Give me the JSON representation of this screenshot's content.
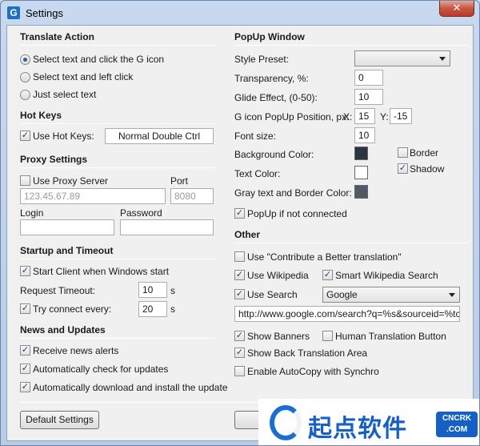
{
  "window": {
    "title": "Settings",
    "app_icon_glyph": "G",
    "close_glyph": "✕"
  },
  "translate_action": {
    "title": "Translate Action",
    "options": [
      {
        "label": "Select text and click the G icon",
        "selected": true
      },
      {
        "label": "Select text and left click",
        "selected": false
      },
      {
        "label": "Just select text",
        "selected": false
      }
    ]
  },
  "hot_keys": {
    "title": "Hot Keys",
    "use_label": "Use Hot Keys:",
    "checked": true,
    "value": "Normal Double Ctrl"
  },
  "proxy": {
    "title": "Proxy Settings",
    "use_label": "Use Proxy Server",
    "checked": false,
    "port_label": "Port",
    "server_value": "123.45.67.89",
    "port_value": "8080",
    "login_label": "Login",
    "password_label": "Password",
    "login_value": "",
    "password_value": ""
  },
  "startup": {
    "title": "Startup and Timeout",
    "start_client_label": "Start Client when Windows start",
    "start_client_checked": true,
    "request_timeout_label": "Request Timeout:",
    "request_timeout_value": "10",
    "request_timeout_unit": "s",
    "try_connect_label": "Try connect every:",
    "try_connect_checked": true,
    "try_connect_value": "20",
    "try_connect_unit": "s"
  },
  "news": {
    "title": "News and Updates",
    "items": [
      {
        "label": "Receive news alerts",
        "checked": true
      },
      {
        "label": "Automatically check for updates",
        "checked": true
      },
      {
        "label": "Automatically download and install the update",
        "checked": true
      }
    ]
  },
  "popup": {
    "title": "PopUp Window",
    "style_preset_label": "Style Preset:",
    "style_preset_value": "",
    "transparency_label": "Transparency, %:",
    "transparency_value": "0",
    "glide_label": "Glide Effect, (0-50):",
    "glide_value": "10",
    "position_label": "G icon PopUp Position, px:",
    "x_label": "X:",
    "x_value": "15",
    "y_label": "Y:",
    "y_value": "-15",
    "font_size_label": "Font size:",
    "font_size_value": "10",
    "bg_color_label": "Background Color:",
    "bg_color": "#2a3540",
    "text_color_label": "Text Color:",
    "text_color": "#ffffff",
    "gray_color_label": "Gray text and Border Color:",
    "gray_color": "#505a64",
    "border_label": "Border",
    "border_checked": false,
    "shadow_label": "Shadow",
    "shadow_checked": true,
    "popup_if_label": "PopUp if not connected",
    "popup_if_checked": true
  },
  "other": {
    "title": "Other",
    "contribute_label": "Use \"Contribute a Better translation\"",
    "contribute_checked": false,
    "wikipedia_label": "Use Wikipedia",
    "wikipedia_checked": true,
    "smart_wiki_label": "Smart Wikipedia Search",
    "smart_wiki_checked": true,
    "use_search_label": "Use Search",
    "use_search_checked": true,
    "search_engine": "Google",
    "search_url": "http://www.google.com/search?q=%s&sourceid=%tc&ie",
    "show_banners_label": "Show Banners",
    "show_banners_checked": true,
    "human_translation_label": "Human Translation Button",
    "human_translation_checked": false,
    "back_translation_label": "Show Back Translation Area",
    "back_translation_checked": true,
    "autocopy_label": "Enable AutoCopy with Synchro",
    "autocopy_checked": false
  },
  "buttons": {
    "default_settings": "Default Settings"
  },
  "watermark": {
    "text": "起点软件",
    "badge_top": "CNCRK",
    "badge_bottom": ".COM"
  },
  "check_glyph": "✓"
}
